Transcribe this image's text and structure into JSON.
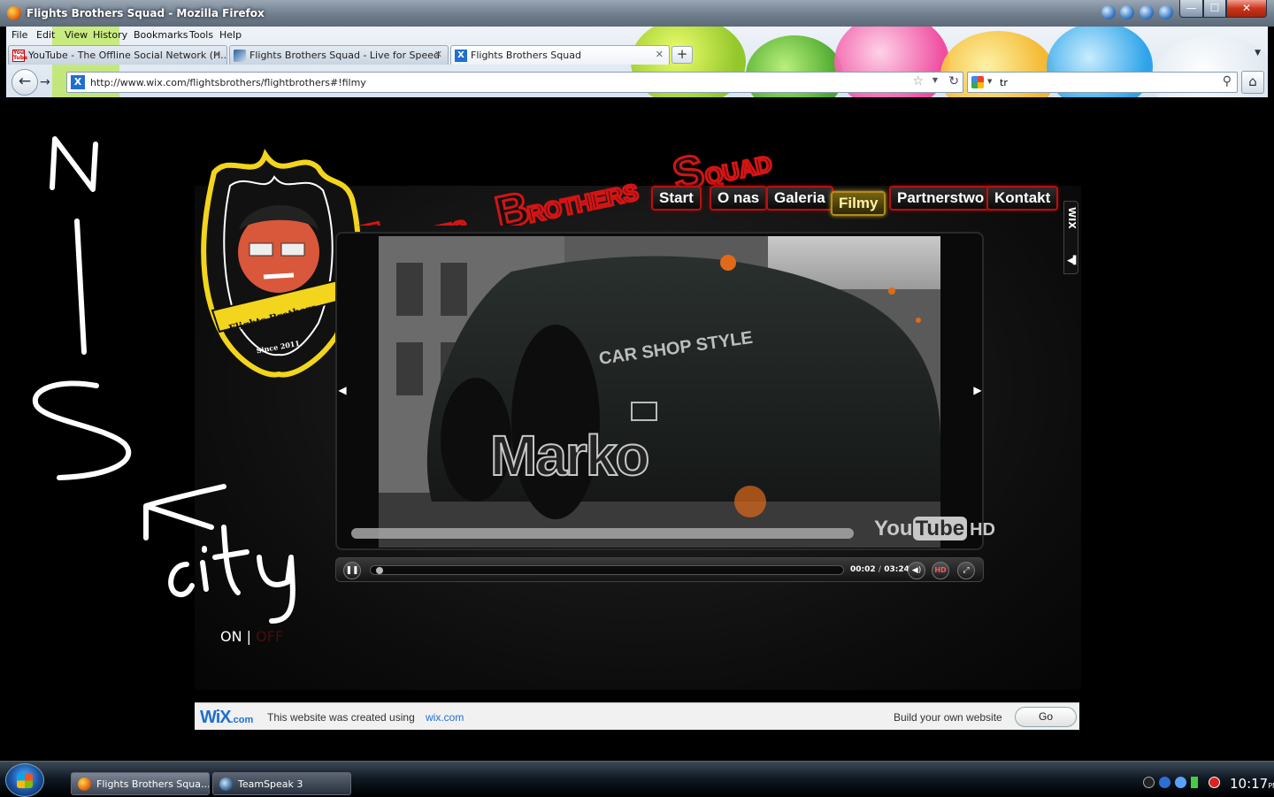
{
  "window": {
    "title": "Flights Brothers Squad - Mozilla Firefox",
    "buttons": {
      "minimize": "—",
      "maximize": "☐",
      "close": "✕"
    }
  },
  "browser": {
    "menu": [
      "File",
      "Edit",
      "View",
      "History",
      "Bookmarks",
      "Tools",
      "Help"
    ],
    "tabs": [
      {
        "label": "YouTube - The Offline Social Network (H...",
        "icon": "youtube-icon",
        "active": false
      },
      {
        "label": "Flights Brothers Squad - Live for Speed",
        "icon": "lfs-icon",
        "active": false
      },
      {
        "label": "Flights Brothers Squad",
        "icon": "wix-icon",
        "active": true
      }
    ],
    "new_tab_label": "+",
    "url": "http://www.wix.com/flightsbrothers/flightbrothers#!filmy",
    "search_query": "tr",
    "icons": {
      "back": "back-arrow-icon",
      "forward": "forward-arrow-icon",
      "bookmark": "star-icon",
      "reload": "reload-icon",
      "search": "magnifier-icon",
      "home": "home-icon"
    }
  },
  "site": {
    "nav": [
      {
        "label": "Start",
        "active": false
      },
      {
        "label": "O nas",
        "active": false
      },
      {
        "label": "Galeria",
        "active": false
      },
      {
        "label": "Filmy",
        "active": true
      },
      {
        "label": "Partnerstwo",
        "active": false
      },
      {
        "label": "Kontakt",
        "active": false
      }
    ],
    "logo": {
      "line1": "Flights Brothers",
      "line2": "Squad",
      "since": "Since 2011",
      "accent_color": "#f2d51c"
    },
    "brand_title": {
      "words": [
        {
          "big": "F",
          "rest": "LIGHTS"
        },
        {
          "big": "B",
          "rest": "ROTHERS"
        },
        {
          "big": "S",
          "rest": "QUAD"
        }
      ],
      "color": "#d41414"
    },
    "video": {
      "caption": "Marko",
      "overlay_text": "CAR SHOP STYLE",
      "current_time": "00:02",
      "time_separator": "/",
      "duration": "03:24",
      "played_fraction": 0.01,
      "hd_label": "HD",
      "youtube_logo": {
        "you": "You",
        "tube": "Tube",
        "hd": "HD"
      }
    },
    "handwriting": [
      "N",
      "I",
      "S",
      "city"
    ],
    "toggle": {
      "on": "ON",
      "separator": "|",
      "off": "OFF"
    },
    "wix_side_label": "WIX"
  },
  "wix_banner": {
    "logo": "WiX",
    "logo_suffix": ".com",
    "text": "This website was created using",
    "link": "wix.com",
    "cta_text": "Build your own website",
    "button": "Go",
    "brand_color": "#1f6fd0"
  },
  "taskbar": {
    "tasks": [
      {
        "label": "Flights Brothers Squa...",
        "icon": "firefox-icon"
      },
      {
        "label": "TeamSpeak 3",
        "icon": "teamspeak-icon"
      }
    ],
    "clock": "10:17",
    "clock_suffix": "PM"
  }
}
